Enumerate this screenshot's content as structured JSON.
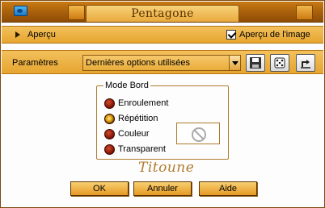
{
  "window": {
    "title": "Pentagone",
    "icon": "app-icon"
  },
  "preview": {
    "label": "Aperçu",
    "image_preview_label": "Aperçu de l'image",
    "image_preview_checked": true
  },
  "parameters": {
    "label": "Paramètres",
    "preset": "Dernières options utilisées",
    "tools": [
      "save-icon",
      "random-dice-icon",
      "reset-icon"
    ]
  },
  "edge_mode": {
    "legend": "Mode Bord",
    "options": [
      {
        "label": "Enroulement",
        "selected": false
      },
      {
        "label": "Répétition",
        "selected": true
      },
      {
        "label": "Couleur",
        "selected": false
      },
      {
        "label": "Transparent",
        "selected": false
      }
    ],
    "color_swatch_icon": "no-color-icon"
  },
  "signature": "Titoune",
  "buttons": {
    "ok": "OK",
    "cancel": "Annuler",
    "help": "Aide"
  },
  "colors": {
    "accent": "#e6a52f",
    "accent_light": "#f3c15d",
    "title_bar": "#a45c0a",
    "border": "#b07a2c"
  }
}
